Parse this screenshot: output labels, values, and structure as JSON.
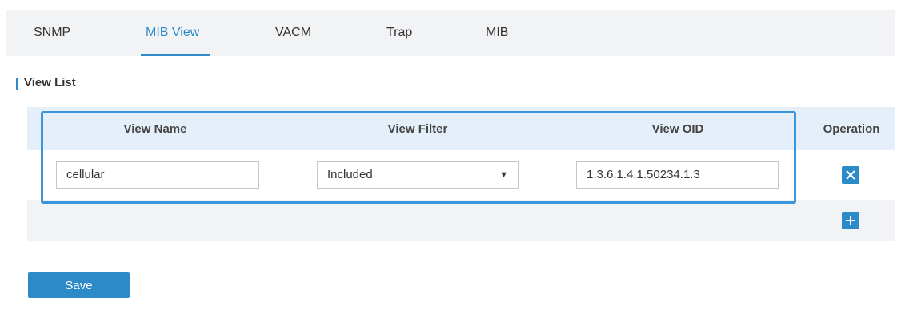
{
  "tabs": [
    "SNMP",
    "MIB View",
    "VACM",
    "Trap",
    "MIB"
  ],
  "active_tab": "MIB View",
  "section": {
    "title": "View List"
  },
  "table": {
    "headers": {
      "view_name": "View Name",
      "view_filter": "View Filter",
      "view_oid": "View OID",
      "operation": "Operation"
    },
    "rows": [
      {
        "view_name": "cellular",
        "view_filter": "Included",
        "view_oid": "1.3.6.1.4.1.50234.1.3"
      }
    ]
  },
  "icons": {
    "delete": "close-icon",
    "add": "plus-icon"
  },
  "colors": {
    "accent": "#2c8ac9",
    "highlight_border": "#3a95dc",
    "header_bg": "#e4eff9"
  },
  "save_label": "Save"
}
